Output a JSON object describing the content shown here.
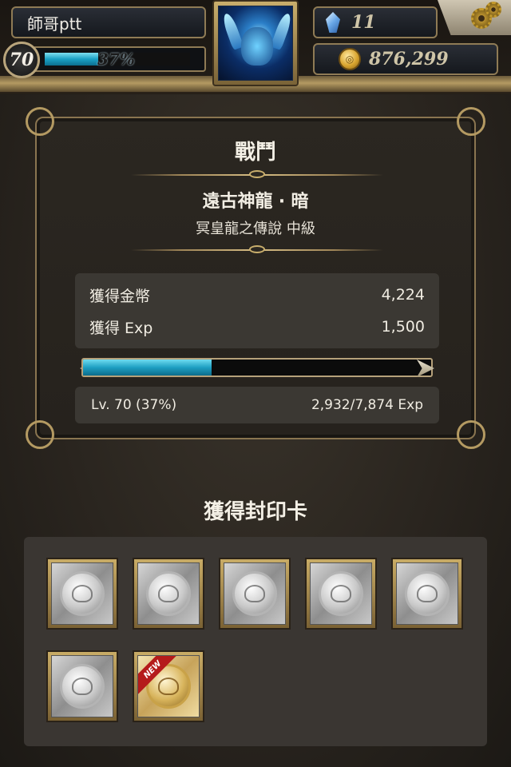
{
  "header": {
    "player_name": "師哥ptt",
    "level": "70",
    "exp_percent_text": "37%",
    "exp_fraction": 0.37,
    "gems": "11",
    "gold": "876,299",
    "gem_icon": "crystal-gem-icon",
    "coin_icon": "gold-coin-icon",
    "settings_icon": "gear-icon"
  },
  "battle": {
    "title": "戰鬥",
    "boss_name": "遠古神龍 ‧ 暗",
    "stage_name": "冥皇龍之傳說 中級",
    "rewards": [
      {
        "label": "獲得金幣",
        "value": "4,224"
      },
      {
        "label": "獲得 Exp",
        "value": "1,500"
      }
    ],
    "level_bar_fraction": 0.37,
    "level_text": "Lv. 70 (37%)",
    "exp_text": "2,932/7,874 Exp"
  },
  "cards": {
    "title": "獲得封印卡",
    "new_label": "NEW",
    "items": [
      {
        "type": "silver"
      },
      {
        "type": "silver"
      },
      {
        "type": "silver"
      },
      {
        "type": "silver"
      },
      {
        "type": "silver"
      },
      {
        "type": "silver"
      },
      {
        "type": "gold",
        "is_new": true
      }
    ]
  },
  "colors": {
    "exp_bar": "#1aa0c4",
    "gold_frame": "#b49a62",
    "background": "#2a251f",
    "new_badge": "#b51b1b"
  }
}
